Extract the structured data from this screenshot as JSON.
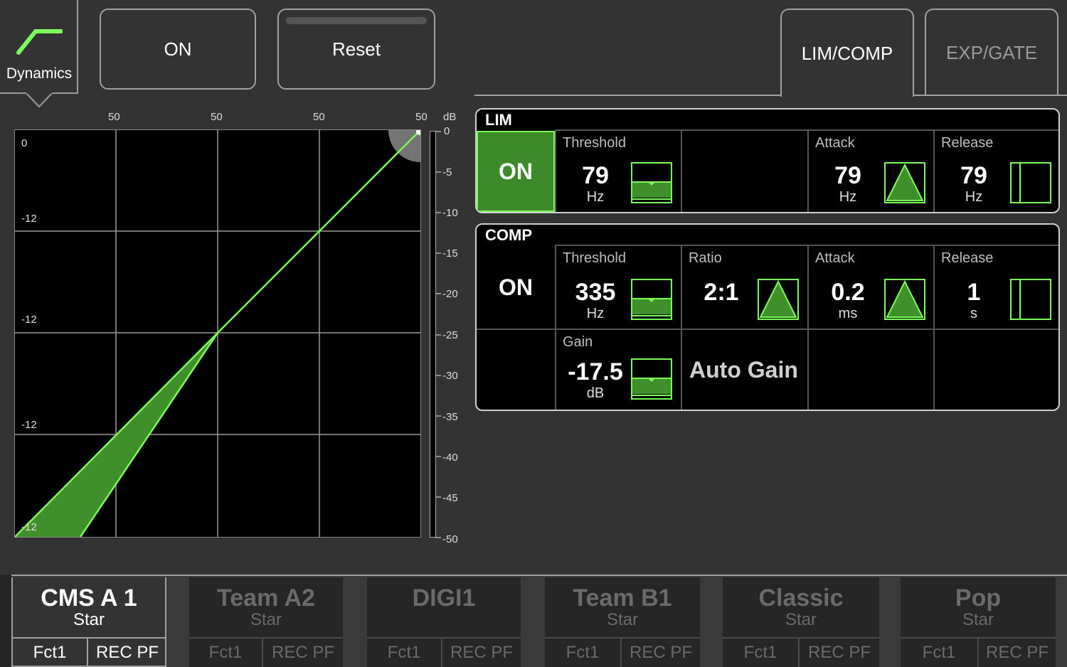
{
  "header": {
    "module_label": "Dynamics",
    "on_button": "ON",
    "reset_button": "Reset"
  },
  "tabs": [
    {
      "label": "LIM/COMP",
      "active": true
    },
    {
      "label": "EXP/GATE",
      "active": false
    }
  ],
  "graph": {
    "top_ticks": [
      "50",
      "50",
      "50",
      "50"
    ],
    "top_unit": "dB",
    "left_ticks": [
      "0",
      "-12",
      "-12",
      "-12",
      "-12"
    ],
    "meter_ticks": [
      "0",
      "-5",
      "-10",
      "-15",
      "-20",
      "-25",
      "-30",
      "-35",
      "-40",
      "-45",
      "-50"
    ],
    "colors": {
      "curve": "#7CFC5A",
      "fill": "#3f8f2a",
      "grid": "#9a9a9a"
    }
  },
  "lim": {
    "title": "LIM",
    "on_label": "ON",
    "threshold": {
      "title": "Threshold",
      "value": "79",
      "unit": "Hz",
      "icon": "fader-icon"
    },
    "attack": {
      "title": "Attack",
      "value": "79",
      "unit": "Hz",
      "icon": "triangle-icon"
    },
    "release": {
      "title": "Release",
      "value": "79",
      "unit": "Hz",
      "icon": "release-icon"
    }
  },
  "comp": {
    "title": "COMP",
    "on_label": "ON",
    "threshold": {
      "title": "Threshold",
      "value": "335",
      "unit": "Hz",
      "icon": "fader-icon"
    },
    "ratio": {
      "title": "Ratio",
      "value": "2:1",
      "icon": "triangle-icon"
    },
    "attack": {
      "title": "Attack",
      "value": "0.2",
      "unit": "ms",
      "icon": "triangle-icon"
    },
    "release": {
      "title": "Release",
      "value": "1",
      "unit": "s",
      "icon": "release-icon"
    },
    "gain": {
      "title": "Gain",
      "value": "-17.5",
      "unit": "dB",
      "icon": "fader-icon"
    },
    "auto_gain": "Auto Gain"
  },
  "channels": [
    {
      "name": "CMS A 1",
      "sub": "Star",
      "fct": "Fct1",
      "rec": "REC PF",
      "active": true
    },
    {
      "name": "Team A2",
      "sub": "Star",
      "fct": "Fct1",
      "rec": "REC PF",
      "active": false
    },
    {
      "name": "DIGI1",
      "sub": "",
      "fct": "Fct1",
      "rec": "REC PF",
      "active": false
    },
    {
      "name": "Team B1",
      "sub": "Star",
      "fct": "Fct1",
      "rec": "REC PF",
      "active": false
    },
    {
      "name": "Classic",
      "sub": "Star",
      "fct": "Fct1",
      "rec": "REC PF",
      "active": false
    },
    {
      "name": "Pop",
      "sub": "Star",
      "fct": "Fct1",
      "rec": "REC PF",
      "active": false
    }
  ],
  "colors": {
    "accent": "#7CFC5A",
    "accent_dark": "#3f8f2a",
    "on_bg": "#3c8a2a"
  }
}
